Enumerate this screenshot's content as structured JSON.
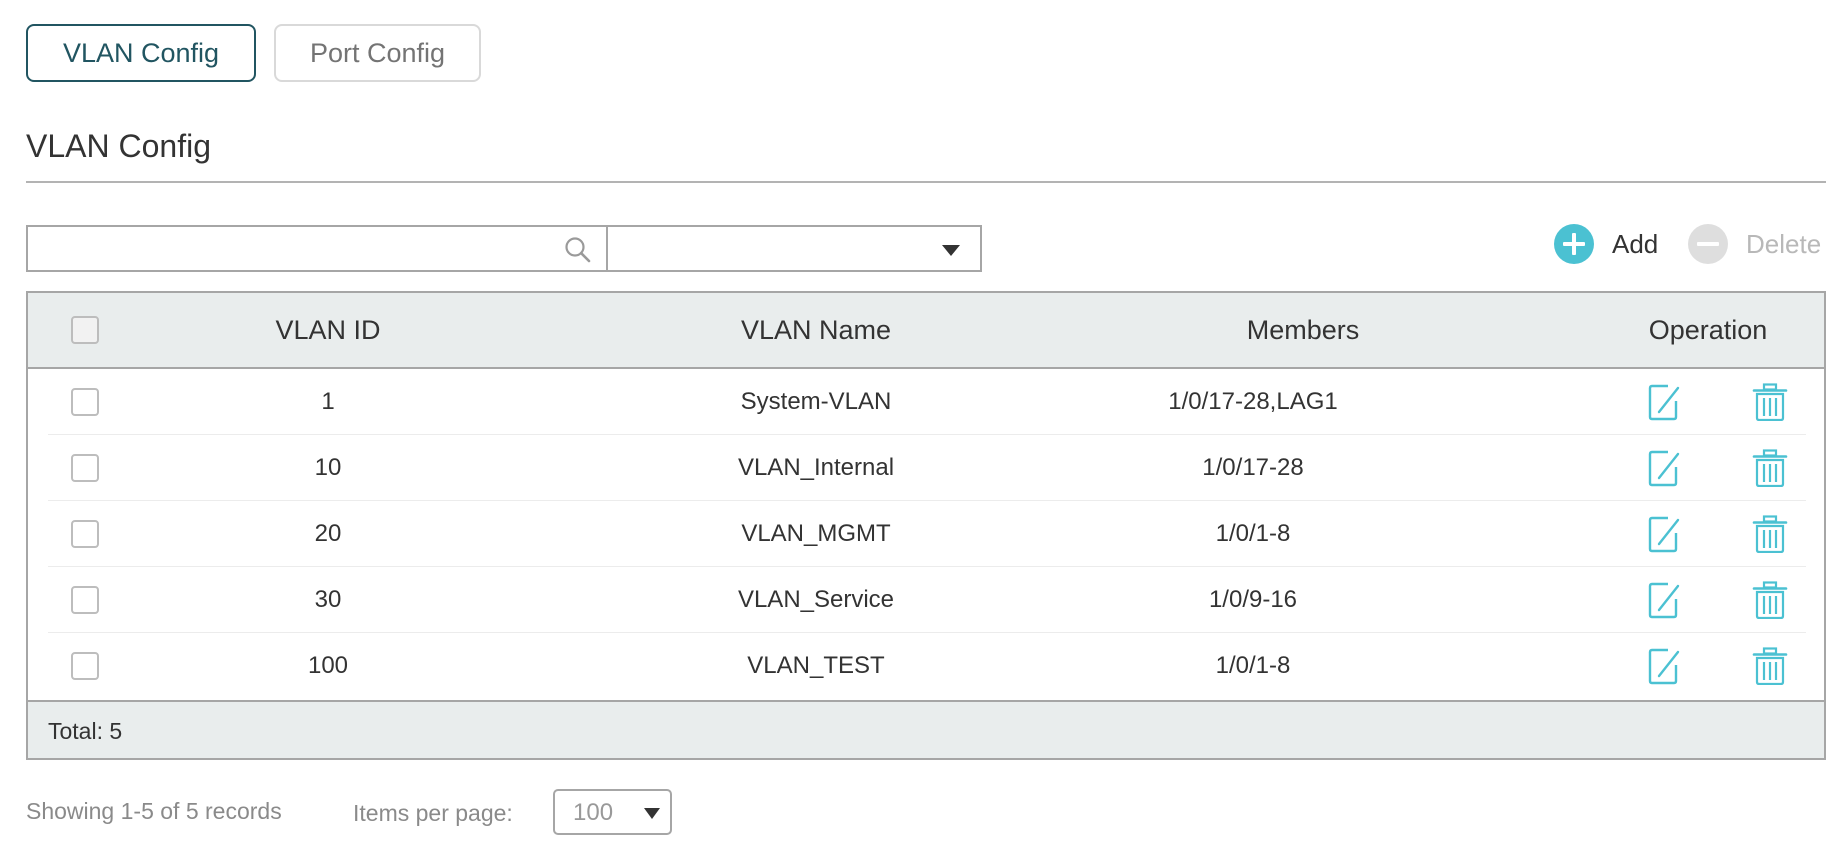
{
  "tabs": [
    {
      "label": "VLAN Config",
      "active": true
    },
    {
      "label": "Port Config",
      "active": false
    }
  ],
  "section": {
    "title": "VLAN Config"
  },
  "search": {
    "value": "",
    "placeholder": "",
    "icon": "search-icon"
  },
  "filter": {
    "selected": ""
  },
  "actions": {
    "add_label": "Add",
    "delete_label": "Delete",
    "add_icon": "plus-circle-icon",
    "delete_icon": "minus-circle-icon"
  },
  "table": {
    "columns": [
      "VLAN ID",
      "VLAN Name",
      "Members",
      "Operation"
    ],
    "rows": [
      {
        "id": "1",
        "name": "System-VLAN",
        "members": "1/0/17-28,LAG1"
      },
      {
        "id": "10",
        "name": "VLAN_Internal",
        "members": "1/0/17-28"
      },
      {
        "id": "20",
        "name": "VLAN_MGMT",
        "members": "1/0/1-8"
      },
      {
        "id": "30",
        "name": "VLAN_Service",
        "members": "1/0/9-16"
      },
      {
        "id": "100",
        "name": "VLAN_TEST",
        "members": "1/0/1-8"
      }
    ],
    "total": "Total: 5"
  },
  "pagination": {
    "info": "Showing 1-5 of 5 records",
    "per_page_label": "Items per page:",
    "per_page_value": "100"
  },
  "colors": {
    "accent": "#215561",
    "icon_teal": "#4bc1d2",
    "header_bg": "#e9eded",
    "border": "#a6a6a6",
    "disabled": "#b8b8b8"
  }
}
